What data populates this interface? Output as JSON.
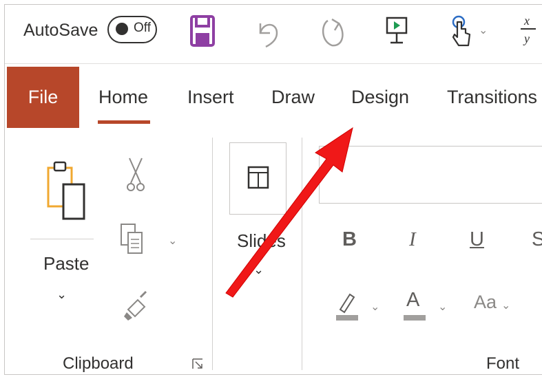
{
  "quick_access": {
    "autosave_label": "AutoSave",
    "autosave_state": "Off"
  },
  "tabs": [
    {
      "label": "File"
    },
    {
      "label": "Home"
    },
    {
      "label": "Insert"
    },
    {
      "label": "Draw"
    },
    {
      "label": "Design"
    },
    {
      "label": "Transitions"
    }
  ],
  "ribbon": {
    "clipboard": {
      "paste_label": "Paste",
      "group_label": "Clipboard"
    },
    "slides": {
      "label": "Slides"
    },
    "font": {
      "bold": "B",
      "italic": "I",
      "underline": "U",
      "strike_partial": "S",
      "font_color_glyph": "A",
      "change_case": "Aa",
      "group_label": "Font"
    }
  },
  "colors": {
    "file_tab": "#b7472a",
    "home_underline": "#b7472a",
    "save_icon": "#8e3fa3",
    "annotation_arrow": "#f01818",
    "paste_icon": "#f0a830"
  }
}
